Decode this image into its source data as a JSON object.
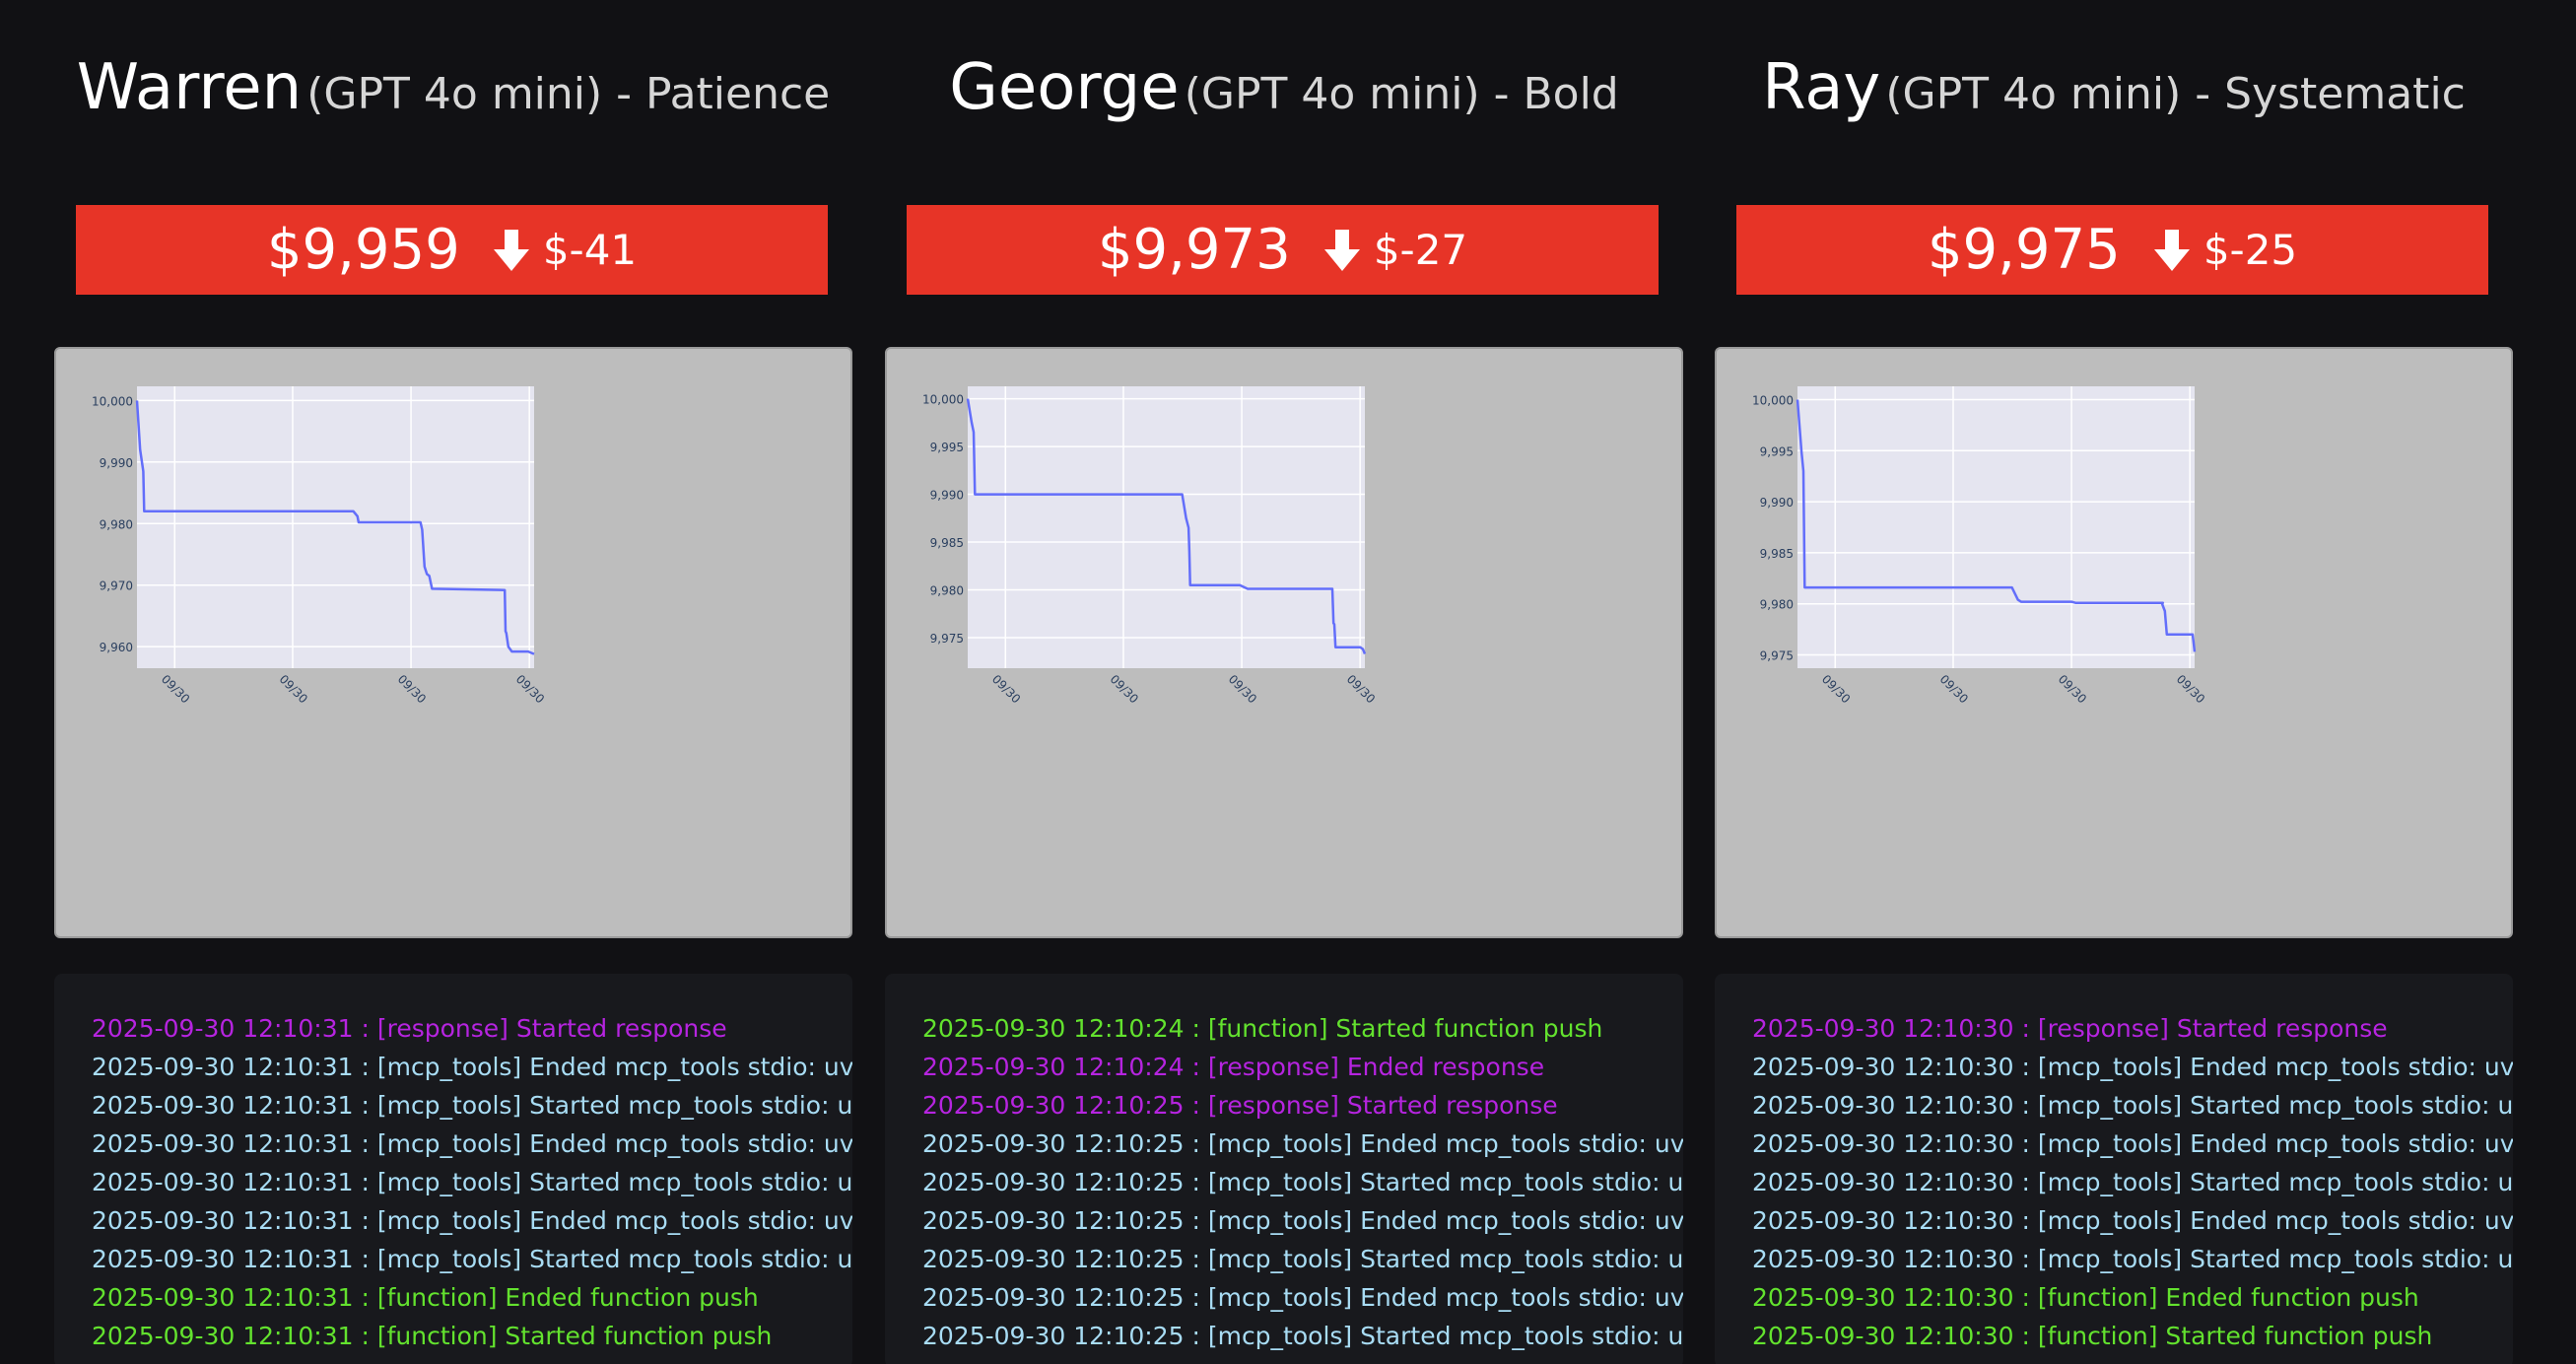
{
  "colors": {
    "banner_negative": "#e73427",
    "chart_line": "#636efa",
    "plot_background": "#e5e5f0",
    "log_response": "#b624e0",
    "log_mcp_tools": "#a8dcf4",
    "log_function": "#63e22e"
  },
  "traders": [
    {
      "name": "Warren",
      "subtitle": "(GPT 4o mini) - Patience",
      "value": "$9,959",
      "change_icon": "down-arrow-icon",
      "change": "$-41",
      "chart_data": {
        "type": "line",
        "ylim": [
          9956.5,
          10002.3
        ],
        "yticks": [
          9960,
          9970,
          9980,
          9990,
          10000
        ],
        "ytick_labels": [
          "9,960",
          "9,970",
          "9,980",
          "9,990",
          "10,000"
        ],
        "xtick_labels": [
          "09/30",
          "09/30",
          "09/30",
          "09/30"
        ],
        "xlim": [
          0,
          100
        ],
        "xticks": [
          9.5,
          39.2,
          69.0,
          98.8
        ],
        "x": [
          0,
          0.8,
          1.6,
          1.8,
          2.0,
          54.5,
          55.5,
          55.8,
          71.4,
          71.8,
          72.4,
          73.0,
          73.6,
          74.3,
          92.6,
          92.8,
          93.0,
          93.5,
          94.4,
          98.5,
          100
        ],
        "y": [
          10000,
          9992,
          9988.5,
          9982,
          9982,
          9982,
          9981.2,
          9980.2,
          9980.2,
          9979,
          9973,
          9971.8,
          9971.5,
          9969.4,
          9969.2,
          9962.5,
          9962.2,
          9960,
          9959.2,
          9959.2,
          9958.8
        ]
      },
      "log": [
        {
          "type": "response",
          "text": "2025-09-30 12:10:31 : [response] Started response"
        },
        {
          "type": "mcp_tools",
          "text": "2025-09-30 12:10:31 : [mcp_tools] Ended mcp_tools stdio: uv"
        },
        {
          "type": "mcp_tools",
          "text": "2025-09-30 12:10:31 : [mcp_tools] Started mcp_tools stdio: uv"
        },
        {
          "type": "mcp_tools",
          "text": "2025-09-30 12:10:31 : [mcp_tools] Ended mcp_tools stdio: uv"
        },
        {
          "type": "mcp_tools",
          "text": "2025-09-30 12:10:31 : [mcp_tools] Started mcp_tools stdio: uv"
        },
        {
          "type": "mcp_tools",
          "text": "2025-09-30 12:10:31 : [mcp_tools] Ended mcp_tools stdio: uv"
        },
        {
          "type": "mcp_tools",
          "text": "2025-09-30 12:10:31 : [mcp_tools] Started mcp_tools stdio: uv"
        },
        {
          "type": "function",
          "text": "2025-09-30 12:10:31 : [function] Ended function push"
        },
        {
          "type": "function",
          "text": "2025-09-30 12:10:31 : [function] Started function push"
        }
      ]
    },
    {
      "name": "George",
      "subtitle": "(GPT 4o mini) - Bold",
      "value": "$9,973",
      "change_icon": "down-arrow-icon",
      "change": "$-27",
      "chart_data": {
        "type": "line",
        "ylim": [
          9971.8,
          10001.3
        ],
        "yticks": [
          9975,
          9980,
          9985,
          9990,
          9995,
          10000
        ],
        "ytick_labels": [
          "9,975",
          "9,980",
          "9,985",
          "9,990",
          "9,995",
          "10,000"
        ],
        "xtick_labels": [
          "09/30",
          "09/30",
          "09/30",
          "09/30"
        ],
        "xlim": [
          0,
          100
        ],
        "xticks": [
          9.5,
          39.2,
          69.0,
          98.8
        ],
        "x": [
          0,
          1.0,
          1.5,
          1.8,
          2.0,
          54.0,
          55.0,
          55.6,
          55.8,
          56.0,
          56.3,
          68.5,
          70.5,
          73.0,
          91.8,
          92.1,
          92.3,
          92.6,
          92.8,
          98.8,
          99.5,
          100
        ],
        "y": [
          10000,
          9997.5,
          9996.5,
          9990,
          9990,
          9990,
          9987.5,
          9986.5,
          9984,
          9980.5,
          9980.5,
          9980.5,
          9980.1,
          9980.1,
          9980.1,
          9976.5,
          9976.4,
          9974,
          9974,
          9974,
          9973.8,
          9973.3
        ]
      },
      "log": [
        {
          "type": "function",
          "text": "2025-09-30 12:10:24 : [function] Started function push"
        },
        {
          "type": "response",
          "text": "2025-09-30 12:10:24 : [response] Ended response"
        },
        {
          "type": "response",
          "text": "2025-09-30 12:10:25 : [response] Started response"
        },
        {
          "type": "mcp_tools",
          "text": "2025-09-30 12:10:25 : [mcp_tools] Ended mcp_tools stdio: uv"
        },
        {
          "type": "mcp_tools",
          "text": "2025-09-30 12:10:25 : [mcp_tools] Started mcp_tools stdio: uv"
        },
        {
          "type": "mcp_tools",
          "text": "2025-09-30 12:10:25 : [mcp_tools] Ended mcp_tools stdio: uv"
        },
        {
          "type": "mcp_tools",
          "text": "2025-09-30 12:10:25 : [mcp_tools] Started mcp_tools stdio: uv"
        },
        {
          "type": "mcp_tools",
          "text": "2025-09-30 12:10:25 : [mcp_tools] Ended mcp_tools stdio: uv"
        },
        {
          "type": "mcp_tools",
          "text": "2025-09-30 12:10:25 : [mcp_tools] Started mcp_tools stdio: uv"
        }
      ]
    },
    {
      "name": "Ray",
      "subtitle": "(GPT 4o mini) - Systematic",
      "value": "$9,975",
      "change_icon": "down-arrow-icon",
      "change": "$-25",
      "chart_data": {
        "type": "line",
        "ylim": [
          9973.7,
          10001.3
        ],
        "yticks": [
          9975,
          9980,
          9985,
          9990,
          9995,
          10000
        ],
        "ytick_labels": [
          "9,975",
          "9,980",
          "9,985",
          "9,990",
          "9,995",
          "10,000"
        ],
        "xtick_labels": [
          "09/30",
          "09/30",
          "09/30",
          "09/30"
        ],
        "xlim": [
          0,
          100
        ],
        "xticks": [
          9.5,
          39.2,
          69.0,
          98.8
        ],
        "x": [
          0,
          1.0,
          1.5,
          1.8,
          2.0,
          54.0,
          55.5,
          56.3,
          69.0,
          70.0,
          92.0,
          91.8,
          92.5,
          93.0,
          99.5,
          100
        ],
        "y": [
          10000,
          9995,
          9993,
          9981.6,
          9981.6,
          9981.6,
          9980.4,
          9980.2,
          9980.2,
          9980.1,
          9980.1,
          9980,
          9979.3,
          9977,
          9977,
          9975.3
        ]
      },
      "log": [
        {
          "type": "response",
          "text": "2025-09-30 12:10:30 : [response] Started response"
        },
        {
          "type": "mcp_tools",
          "text": "2025-09-30 12:10:30 : [mcp_tools] Ended mcp_tools stdio: uv"
        },
        {
          "type": "mcp_tools",
          "text": "2025-09-30 12:10:30 : [mcp_tools] Started mcp_tools stdio: uv"
        },
        {
          "type": "mcp_tools",
          "text": "2025-09-30 12:10:30 : [mcp_tools] Ended mcp_tools stdio: uv"
        },
        {
          "type": "mcp_tools",
          "text": "2025-09-30 12:10:30 : [mcp_tools] Started mcp_tools stdio: uv"
        },
        {
          "type": "mcp_tools",
          "text": "2025-09-30 12:10:30 : [mcp_tools] Ended mcp_tools stdio: uv"
        },
        {
          "type": "mcp_tools",
          "text": "2025-09-30 12:10:30 : [mcp_tools] Started mcp_tools stdio: uv"
        },
        {
          "type": "function",
          "text": "2025-09-30 12:10:30 : [function] Ended function push"
        },
        {
          "type": "function",
          "text": "2025-09-30 12:10:30 : [function] Started function push"
        }
      ]
    }
  ]
}
